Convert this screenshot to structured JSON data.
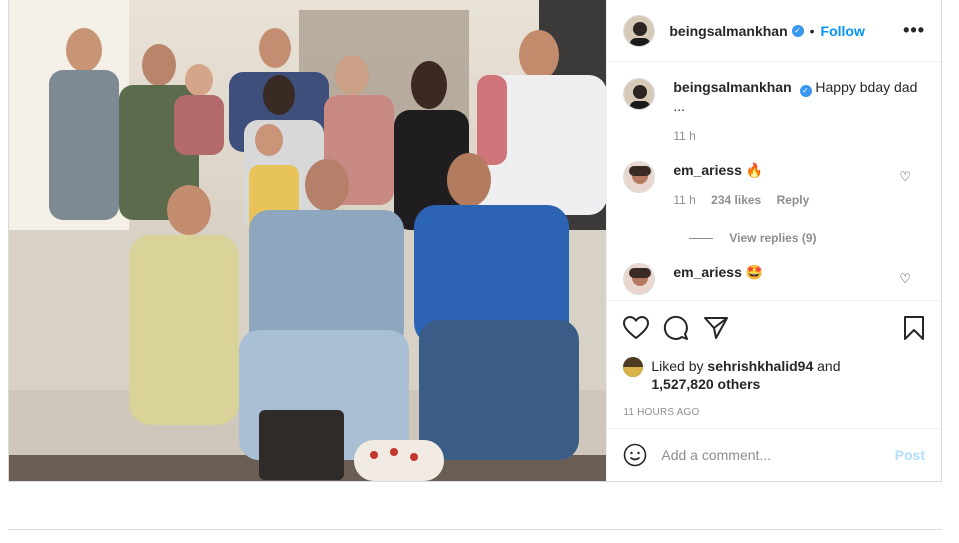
{
  "post": {
    "username": "beingsalmankhan",
    "follow_label": "Follow",
    "separator": "•",
    "more_label": "•••",
    "photo_icon": "family-photo",
    "caption": "Happy bday dad ...",
    "caption_time": "11 h"
  },
  "comments": [
    {
      "user": "em_ariess",
      "text": "🔥",
      "time": "11 h",
      "likes": "234 likes",
      "reply_label": "Reply",
      "view_replies": "View replies (9)"
    },
    {
      "user": "em_ariess",
      "text": "🤩"
    }
  ],
  "engagement": {
    "liked_by_prefix": "Liked by",
    "liked_by_user": "sehrishkhalid94",
    "liked_by_and": "and",
    "others": "1,527,820 others",
    "time_ago": "11 HOURS AGO"
  },
  "add_comment": {
    "placeholder": "Add a comment...",
    "post_label": "Post",
    "emoji_icon": "smiley-icon"
  },
  "colors": {
    "accent": "#0095f6",
    "muted": "#8e8e8e",
    "border": "#dbdbdb"
  }
}
